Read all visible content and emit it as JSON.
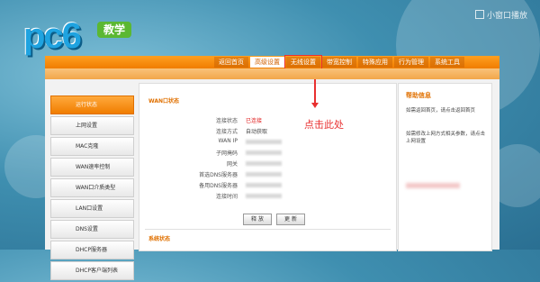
{
  "logo": {
    "text": "pc6",
    "badge": "教学"
  },
  "watermark": {
    "text": "小窗口播放"
  },
  "nav": {
    "tabs": [
      {
        "label": "返回首页"
      },
      {
        "label": "高级设置"
      },
      {
        "label": "无线设置"
      },
      {
        "label": "带宽控制"
      },
      {
        "label": "特殊应用"
      },
      {
        "label": "行为管理"
      },
      {
        "label": "系统工具"
      }
    ]
  },
  "sidebar": {
    "items": [
      {
        "label": "运行状态"
      },
      {
        "label": "上网设置"
      },
      {
        "label": "MAC克隆"
      },
      {
        "label": "WAN速率控制"
      },
      {
        "label": "WAN口介质类型"
      },
      {
        "label": "LAN口设置"
      },
      {
        "label": "DNS设置"
      },
      {
        "label": "DHCP服务器"
      },
      {
        "label": "DHCP客户端列表"
      }
    ]
  },
  "wan": {
    "title": "WAN口状态",
    "rows": [
      {
        "label": "连接状态",
        "value": "已连接"
      },
      {
        "label": "连接方式",
        "value": "自动获取"
      },
      {
        "label": "WAN IP",
        "value": ""
      },
      {
        "label": "子网掩码",
        "value": ""
      },
      {
        "label": "网关",
        "value": ""
      },
      {
        "label": "首选DNS服务器",
        "value": ""
      },
      {
        "label": "备用DNS服务器",
        "value": ""
      },
      {
        "label": "连接时间",
        "value": ""
      }
    ],
    "release_button": "释 放",
    "renew_button": "更 新"
  },
  "system": {
    "title": "系统状态"
  },
  "help": {
    "title": "帮助信息",
    "text1": "如需返回首页，请点击返回首页",
    "text2": "如需修改上网方式相关参数，请点击上网设置"
  },
  "annotation": {
    "text": "点击此处",
    "color": "#e83030"
  },
  "colors": {
    "accent": "#f07d00",
    "status_connected": "#e02020"
  }
}
